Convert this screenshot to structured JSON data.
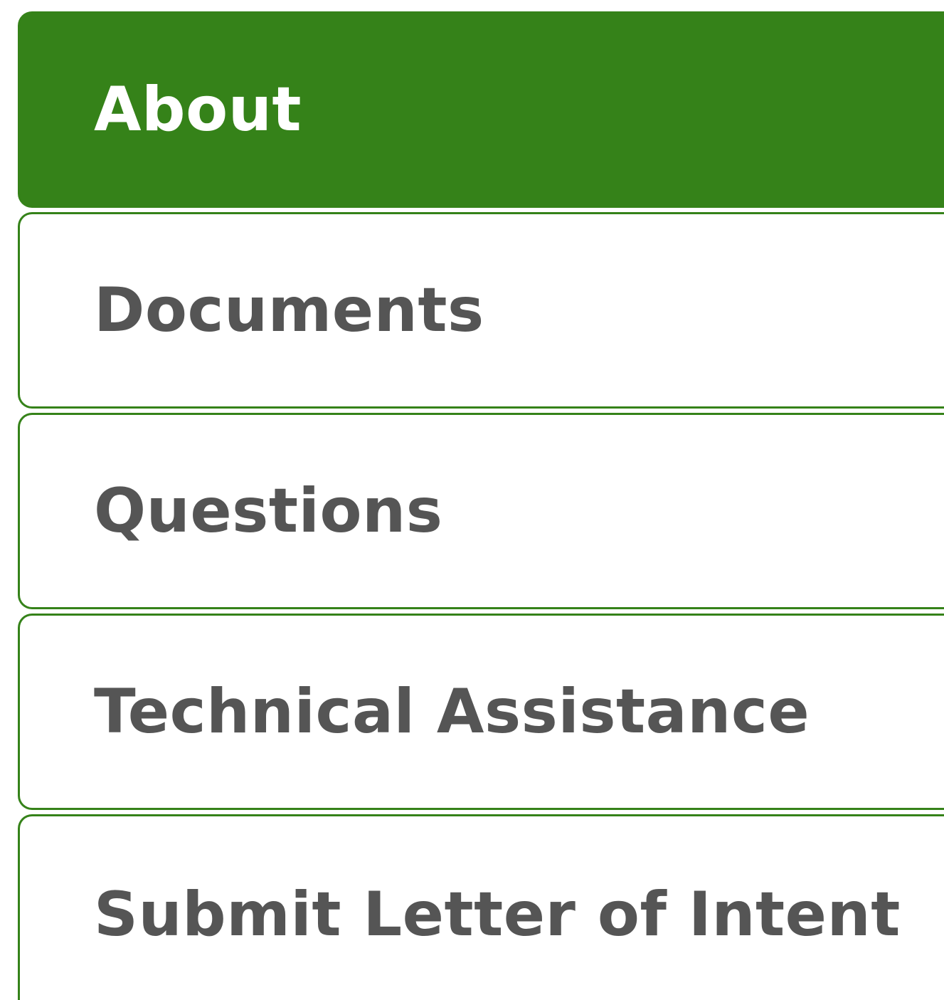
{
  "nav": {
    "items": [
      {
        "label": "About",
        "active": true
      },
      {
        "label": "Documents",
        "active": false
      },
      {
        "label": "Questions",
        "active": false
      },
      {
        "label": "Technical Assistance",
        "active": false
      },
      {
        "label": "Submit Letter of Intent",
        "active": false
      }
    ]
  },
  "colors": {
    "accent": "#358219",
    "text": "#555555",
    "active_text": "#ffffff",
    "background": "#ffffff"
  }
}
